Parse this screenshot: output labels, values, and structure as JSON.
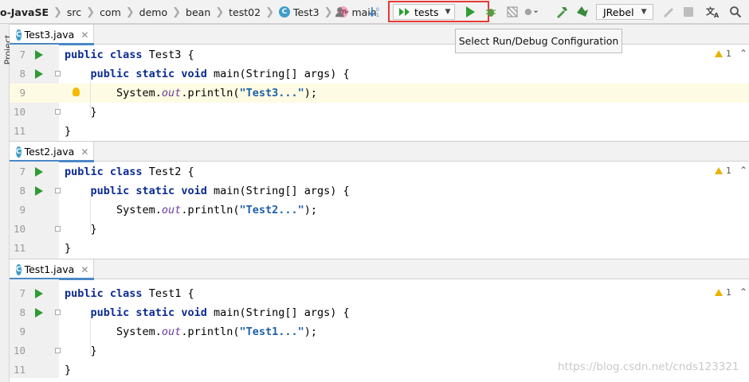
{
  "breadcrumbs": [
    "o-JavaSE",
    "src",
    "com",
    "demo",
    "bean",
    "test02",
    "Test3",
    "main"
  ],
  "toolbar": {
    "run_config": "tests",
    "jrebel": "JRebel"
  },
  "tooltip": "Select Run/Debug Configuration",
  "sidebar": {
    "label": "Project"
  },
  "editors": [
    {
      "tab": "Test3.java",
      "warning": "1",
      "lines": [
        {
          "num": "7",
          "parts": [
            [
              "kw",
              "public "
            ],
            [
              "kw",
              "class "
            ],
            [
              "",
              "Test3 {"
            ]
          ]
        },
        {
          "num": "8",
          "parts": [
            [
              "",
              "    "
            ],
            [
              "kw",
              "public "
            ],
            [
              "kw",
              "static "
            ],
            [
              "kw",
              "void "
            ],
            [
              "",
              "main(String[] args) {"
            ]
          ]
        },
        {
          "num": "9",
          "parts": [
            [
              "",
              "        System."
            ],
            [
              "it",
              "out"
            ],
            [
              "",
              ".println("
            ],
            [
              "str",
              "\"Test3...\""
            ],
            [
              "",
              ");"
            ]
          ]
        },
        {
          "num": "10",
          "parts": [
            [
              "",
              "    }"
            ]
          ]
        },
        {
          "num": "11",
          "parts": [
            [
              "",
              "}"
            ]
          ]
        }
      ]
    },
    {
      "tab": "Test2.java",
      "warning": "1",
      "lines": [
        {
          "num": "7",
          "parts": [
            [
              "kw",
              "public "
            ],
            [
              "kw",
              "class "
            ],
            [
              "",
              "Test2 {"
            ]
          ]
        },
        {
          "num": "8",
          "parts": [
            [
              "",
              "    "
            ],
            [
              "kw",
              "public "
            ],
            [
              "kw",
              "static "
            ],
            [
              "kw",
              "void "
            ],
            [
              "",
              "main(String[] args) {"
            ]
          ]
        },
        {
          "num": "9",
          "parts": [
            [
              "",
              "        System."
            ],
            [
              "it",
              "out"
            ],
            [
              "",
              ".println("
            ],
            [
              "str",
              "\"Test2...\""
            ],
            [
              "",
              ");"
            ]
          ]
        },
        {
          "num": "10",
          "parts": [
            [
              "",
              "    }"
            ]
          ]
        },
        {
          "num": "11",
          "parts": [
            [
              "",
              "}"
            ]
          ]
        }
      ]
    },
    {
      "tab": "Test1.java",
      "warning": "1",
      "lines": [
        {
          "num": "7",
          "parts": [
            [
              "kw",
              "public "
            ],
            [
              "kw",
              "class "
            ],
            [
              "",
              "Test1 {"
            ]
          ]
        },
        {
          "num": "8",
          "parts": [
            [
              "",
              "    "
            ],
            [
              "kw",
              "public "
            ],
            [
              "kw",
              "static "
            ],
            [
              "kw",
              "void "
            ],
            [
              "",
              "main(String[] args) {"
            ]
          ]
        },
        {
          "num": "9",
          "parts": [
            [
              "",
              "        System."
            ],
            [
              "it",
              "out"
            ],
            [
              "",
              ".println("
            ],
            [
              "str",
              "\"Test1...\""
            ],
            [
              "",
              ");"
            ]
          ]
        },
        {
          "num": "10",
          "parts": [
            [
              "",
              "    }"
            ]
          ]
        },
        {
          "num": "11",
          "parts": [
            [
              "",
              "}"
            ]
          ]
        }
      ]
    }
  ],
  "watermark": "https://blog.csdn.net/cnds123321"
}
